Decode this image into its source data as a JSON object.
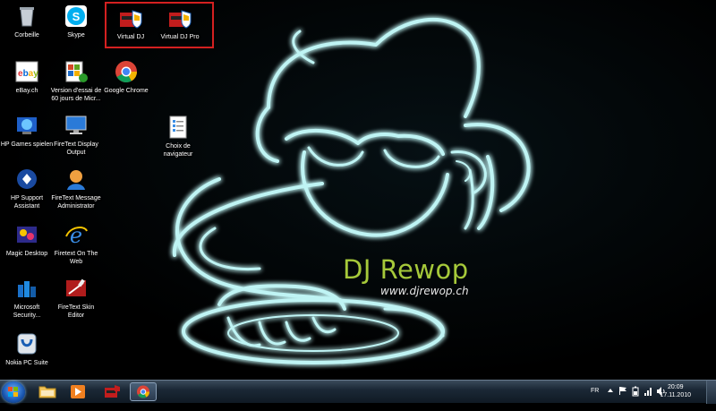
{
  "desktop": {
    "icons": [
      {
        "id": "recycle-bin",
        "label": "Corbeille",
        "icon": "recycle-bin-icon"
      },
      {
        "id": "skype",
        "label": "Skype",
        "icon": "skype-icon"
      },
      {
        "id": "virtual-dj",
        "label": "Virtual DJ",
        "icon": "virtual-dj-icon"
      },
      {
        "id": "virtual-dj-pro",
        "label": "Virtual DJ Pro",
        "icon": "virtual-dj-pro-icon"
      },
      {
        "id": "ebay",
        "label": "eBay.ch",
        "icon": "ebay-icon"
      },
      {
        "id": "office-trial",
        "label": "Version d'essai de 60 jours de Micr...",
        "icon": "office-trial-icon"
      },
      {
        "id": "chrome",
        "label": "Google Chrome",
        "icon": "chrome-icon"
      },
      {
        "id": "hp-games",
        "label": "HP Games spielen",
        "icon": "hp-games-icon"
      },
      {
        "id": "firetext-display",
        "label": "FireText Display Output",
        "icon": "monitor-icon"
      },
      {
        "id": "browser-choice",
        "label": "Choix de navigateur",
        "icon": "browser-choice-icon"
      },
      {
        "id": "hp-support",
        "label": "HP Support Assistant",
        "icon": "hp-support-icon"
      },
      {
        "id": "firetext-message",
        "label": "FireText Message Administrator",
        "icon": "firetext-message-icon"
      },
      {
        "id": "magic-desktop",
        "label": "Magic Desktop",
        "icon": "magic-desktop-icon"
      },
      {
        "id": "firetext-web",
        "label": "Firetext On The Web",
        "icon": "internet-explorer-icon"
      },
      {
        "id": "ms-security",
        "label": "Microsoft Security...",
        "icon": "microsoft-security-icon"
      },
      {
        "id": "firetext-skin",
        "label": "FireText Skin Editor",
        "icon": "firetext-skin-icon"
      },
      {
        "id": "nokia-pc-suite",
        "label": "Nokia PC Suite",
        "icon": "nokia-pc-suite-icon"
      }
    ],
    "wallpaper": {
      "title": "DJ Rewop",
      "url": "www.djrewop.ch",
      "title_color": "#a6c93a",
      "glow_color": "#8fe8e8"
    },
    "highlight_color": "#d42020"
  },
  "taskbar": {
    "pinned": [
      {
        "id": "explorer",
        "icon": "folder-icon"
      },
      {
        "id": "media-player",
        "icon": "media-player-icon"
      },
      {
        "id": "virtual-dj",
        "icon": "virtual-dj-icon"
      },
      {
        "id": "chrome",
        "icon": "chrome-icon",
        "active": true
      }
    ],
    "tray": {
      "language": "FR",
      "time": "20:09",
      "date": "17.11.2010"
    }
  }
}
